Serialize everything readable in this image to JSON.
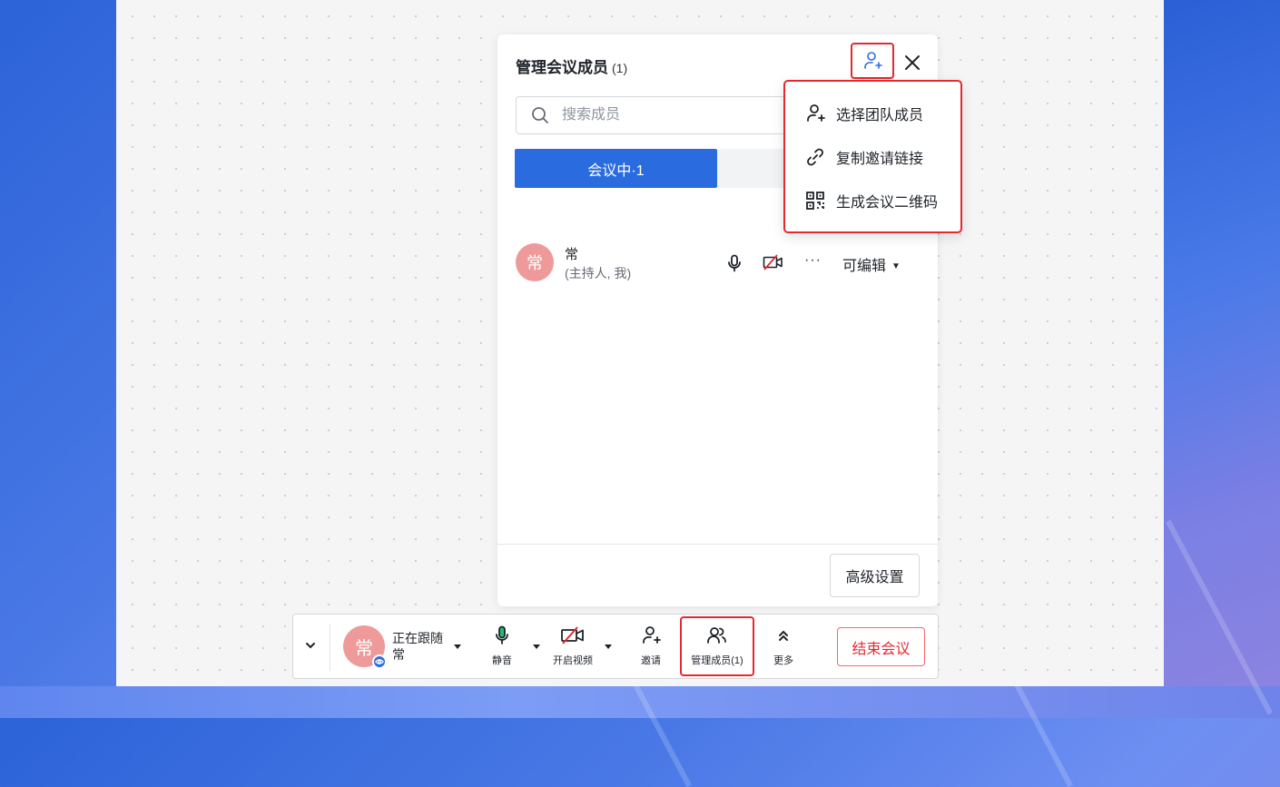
{
  "panel": {
    "title": "管理会议成员",
    "count": "(1)",
    "search_placeholder": "搜索成员",
    "tabs": [
      {
        "label": "会议中·1",
        "active": true
      },
      {
        "label": "",
        "active": false
      }
    ],
    "members": [
      {
        "avatar_text": "常",
        "name": "常",
        "role": "(主持人, 我)",
        "more": "···",
        "permission": "可编辑"
      }
    ],
    "advanced_settings": "高级设置"
  },
  "dropdown": {
    "items": [
      {
        "label": "选择团队成员",
        "icon": "add-user-icon"
      },
      {
        "label": "复制邀请链接",
        "icon": "link-icon"
      },
      {
        "label": "生成会议二维码",
        "icon": "qrcode-icon"
      }
    ]
  },
  "toolbar": {
    "avatar_text": "常",
    "follow_status": "正在跟随",
    "follow_name": "常",
    "mute": "静音",
    "video": "开启视频",
    "invite": "邀请",
    "manage": "管理成员(1)",
    "more": "更多",
    "end": "结束会议"
  },
  "colors": {
    "accent": "#2a6ce0",
    "danger": "#e5292f",
    "avatar": "#ef9a9a"
  }
}
